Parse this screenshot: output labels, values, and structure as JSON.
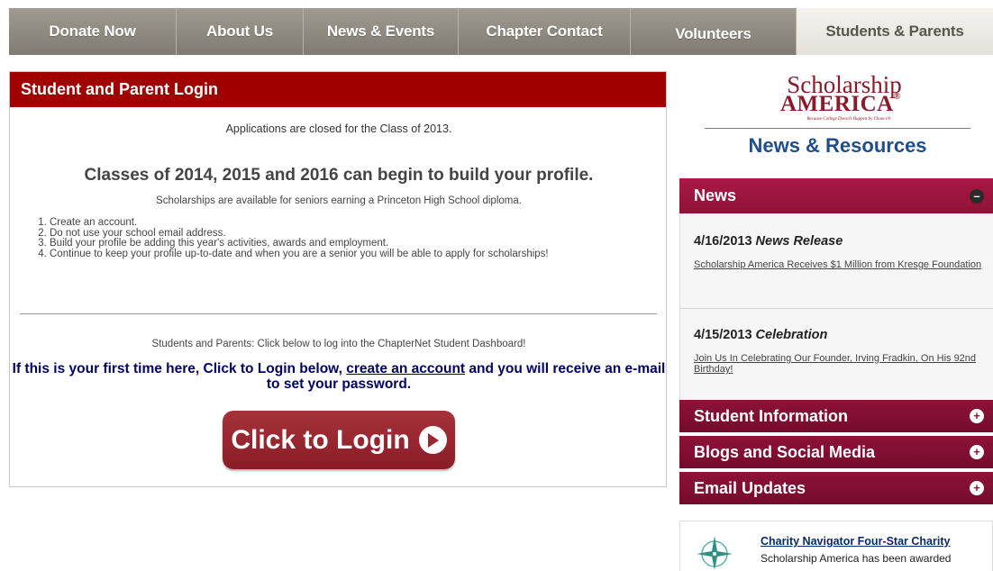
{
  "nav": {
    "tabs": [
      {
        "label": "Donate Now"
      },
      {
        "label": "About Us"
      },
      {
        "label": "News & Events"
      },
      {
        "label": "Chapter Contact"
      },
      {
        "label": "Volunteers"
      },
      {
        "label": "Students & Parents"
      }
    ],
    "active_tab": "Students & Parents"
  },
  "login": {
    "header": "Student and Parent Login",
    "closed_note": "Applications are closed for the Class of 2013.",
    "build_title": "Classes of 2014, 2015 and 2016 can begin to build your profile.",
    "seniors_note": "Scholarships are available for seniors earning a Princeton High School diploma.",
    "steps": [
      "Create an account.",
      "Do not use your school email address.",
      "Build your profile be adding this year's activities, awards and employment.",
      "Continue to keep your profile up-to-date and when you are a senior you will be able to apply for scholarships!"
    ],
    "dashboard_note": "Students and Parents: Click below to log into the ChapterNet Student Dashboard!",
    "first_time_pre": "If this is your first time here, Click to Login below, ",
    "first_time_link": "create an account",
    "first_time_post": " and you will receive an e-mail to set your password.",
    "button_label": "Click to Login"
  },
  "sidebar": {
    "logo_script": "Scholarship",
    "logo_caps": "AMERICA",
    "logo_reg": "®",
    "logo_tagline": "Because College Doesn't Happen by Chance®",
    "section_title": "News & Resources",
    "news": {
      "header": "News",
      "toggle": "–",
      "items": [
        {
          "date": "4/16/2013",
          "kind": "News Release",
          "link": "Scholarship America Receives $1 Million from Kresge Foundation"
        },
        {
          "date": "4/15/2013",
          "kind": "Celebration",
          "link": "Join Us In Celebrating Our Founder, Irving Fradkin, On His 92nd Birthday!"
        }
      ]
    },
    "collapsed_sections": [
      {
        "label": "Student Information",
        "toggle": "+"
      },
      {
        "label": "Blogs and Social Media",
        "toggle": "+"
      },
      {
        "label": "Email Updates",
        "toggle": "+"
      }
    ],
    "charity": {
      "title": "Charity Navigator Four-Star Charity",
      "text": "Scholarship America has been awarded"
    }
  },
  "colors": {
    "login_header": "#a00000",
    "news_header": "#a81a45",
    "link_navy": "#000066",
    "logo_red": "#8b1a2b",
    "resources_blue": "#1f4e8c"
  }
}
